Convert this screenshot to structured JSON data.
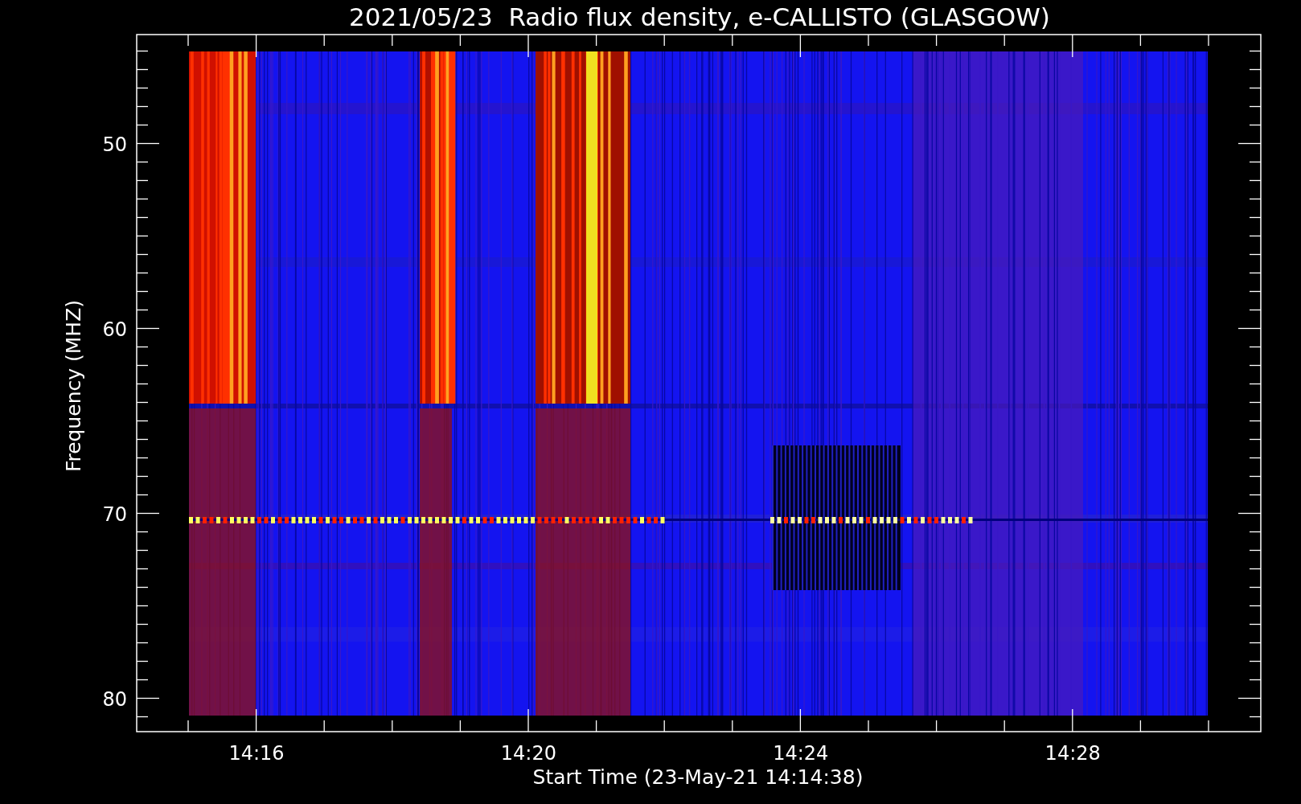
{
  "title": "2021/05/23  Radio flux density, e-CALLISTO (GLASGOW)",
  "plot": {
    "x_axis": {
      "label": "Start Time (23-May-21 14:14:38)",
      "ticks": [
        "14:16",
        "14:20",
        "14:24",
        "14:28"
      ]
    },
    "y_axis": {
      "label": "Frequency (MHZ)",
      "ticks": [
        "50",
        "60",
        "70",
        "80"
      ]
    }
  }
}
